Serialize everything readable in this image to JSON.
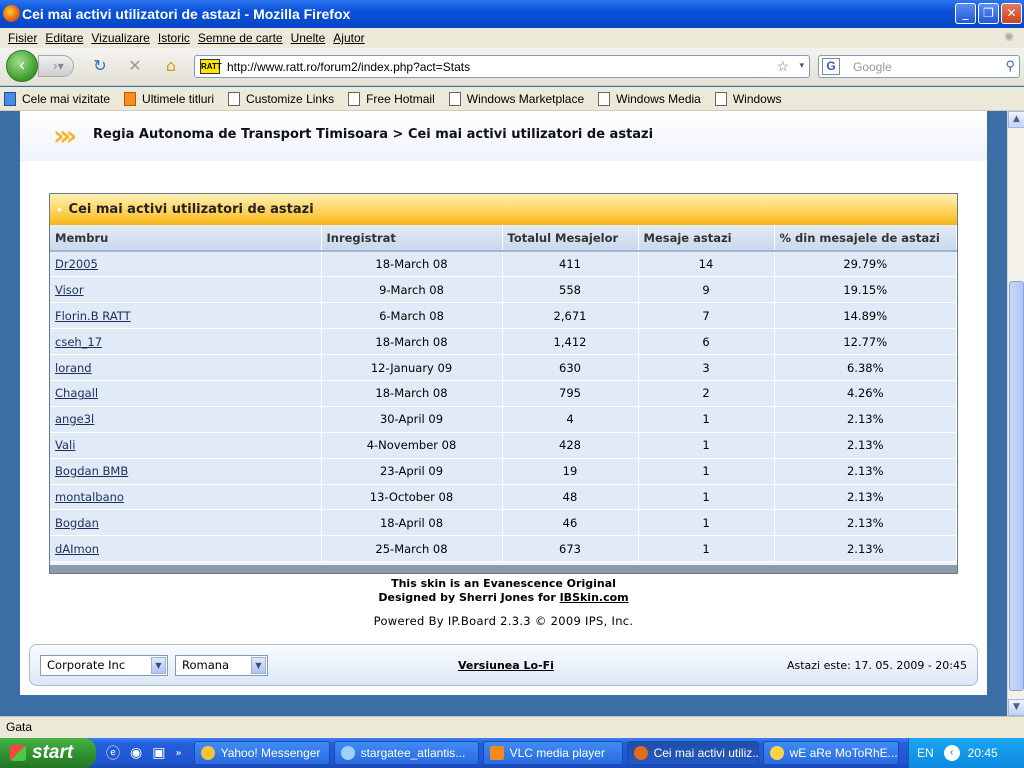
{
  "window": {
    "title": "Cei mai activi utilizatori de astazi - Mozilla Firefox"
  },
  "menu": [
    "Fisier",
    "Editare",
    "Vizualizare",
    "Istoric",
    "Semne de carte",
    "Unelte",
    "Ajutor"
  ],
  "nav": {
    "url": "http://www.ratt.ro/forum2/index.php?act=Stats",
    "favicon_text": "RATT",
    "search_placeholder": "Google"
  },
  "bookmarks": [
    "Cele mai vizitate",
    "Ultimele titluri",
    "Customize Links",
    "Free Hotmail",
    "Windows Marketplace",
    "Windows Media",
    "Windows"
  ],
  "breadcrumb": {
    "site": "Regia Autonoma de Transport Timisoara",
    "separator": ">",
    "current": "Cei mai activi utilizatori de astazi"
  },
  "table": {
    "title": "Cei mai activi utilizatori de astazi",
    "columns": [
      "Membru",
      "Inregistrat",
      "Totalul Mesajelor",
      "Mesaje astazi",
      "% din mesajele de astazi"
    ],
    "rows": [
      [
        "Dr2005",
        "18-March 08",
        "411",
        "14",
        "29.79%"
      ],
      [
        "Visor",
        "9-March 08",
        "558",
        "9",
        "19.15%"
      ],
      [
        "Florin.B RATT",
        "6-March 08",
        "2,671",
        "7",
        "14.89%"
      ],
      [
        "cseh_17",
        "18-March 08",
        "1,412",
        "6",
        "12.77%"
      ],
      [
        "lorand",
        "12-January 09",
        "630",
        "3",
        "6.38%"
      ],
      [
        "Chagall",
        "18-March 08",
        "795",
        "2",
        "4.26%"
      ],
      [
        "ange3l",
        "30-April 09",
        "4",
        "1",
        "2.13%"
      ],
      [
        "Vali",
        "4-November 08",
        "428",
        "1",
        "2.13%"
      ],
      [
        "Bogdan BMB",
        "23-April 09",
        "19",
        "1",
        "2.13%"
      ],
      [
        "montalbano",
        "13-October 08",
        "48",
        "1",
        "2.13%"
      ],
      [
        "Bogdan",
        "18-April 08",
        "46",
        "1",
        "2.13%"
      ],
      [
        "dAImon",
        "25-March 08",
        "673",
        "1",
        "2.13%"
      ]
    ]
  },
  "credits": {
    "line1": "This skin is an Evanescence Original",
    "line2_prefix": "Designed by Sherri Jones for ",
    "line2_link": "IBSkin.com",
    "powered": "Powered By IP.Board 2.3.3 © 2009  IPS, Inc."
  },
  "footer": {
    "skin_select": "Corporate Inc",
    "lang_select": "Romana",
    "lofi": "Versiunea Lo-Fi",
    "date": "Astazi este: 17. 05. 2009 - 20:45"
  },
  "status": "Gata",
  "taskbar": {
    "start": "start",
    "tasks": [
      "Yahoo! Messenger",
      "stargatee_atlantis...",
      "VLC media player",
      "Cei mai activi utiliz...",
      "wE aRe MoToRhE..."
    ],
    "lang": "EN",
    "clock": "20:45"
  }
}
